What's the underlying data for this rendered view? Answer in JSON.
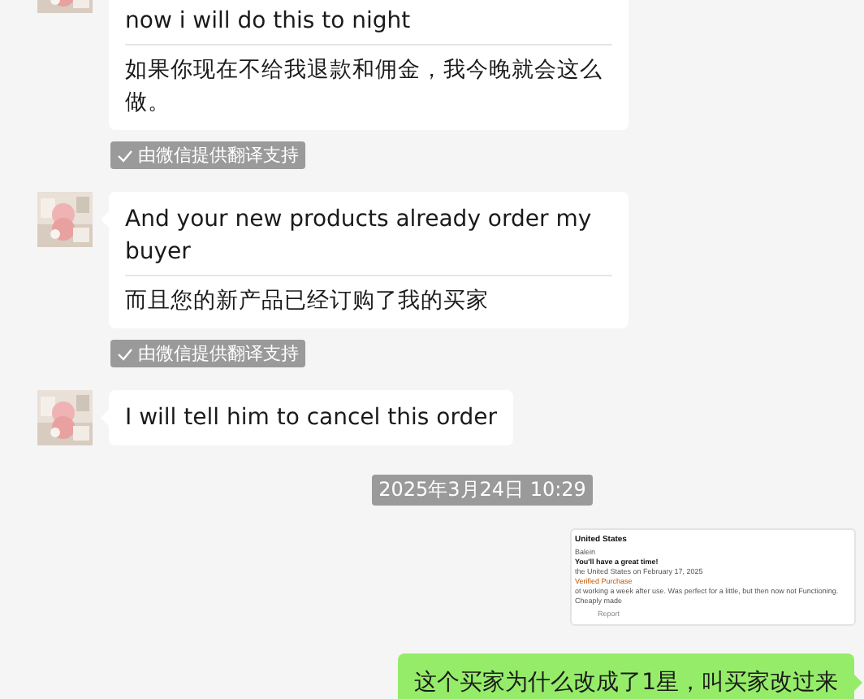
{
  "messages": [
    {
      "kind": "incoming",
      "text": "now i will do this to night",
      "translation": "如果你现在不给我退款和佣金，我今晚就会这么做。",
      "note": "由微信提供翻译支持"
    },
    {
      "kind": "incoming",
      "text": "And your new products already order my buyer",
      "translation": "而且您的新产品已经订购了我的买家",
      "note": "由微信提供翻译支持"
    },
    {
      "kind": "incoming",
      "text": "I will tell him to cancel this order"
    },
    {
      "kind": "time",
      "text": "2025年3月24日 10:29"
    },
    {
      "kind": "screenshot",
      "lines": [
        {
          "kind": "title",
          "text": "United States"
        },
        {
          "kind": "meta",
          "text": "Balein"
        },
        {
          "kind": "headline",
          "text": "You'll have a great time!"
        },
        {
          "kind": "meta",
          "text": "the United States on February 17, 2025"
        },
        {
          "kind": "verified",
          "text": "Verified Purchase"
        },
        {
          "kind": "body",
          "text": "ot working a week after use. Was perfect for a little, but then now not Functioning. Cheaply made"
        },
        {
          "kind": "report",
          "text": "Report"
        }
      ]
    },
    {
      "kind": "outgoing",
      "text": "这个买家为什么改成了1星，叫买家改过来"
    }
  ]
}
